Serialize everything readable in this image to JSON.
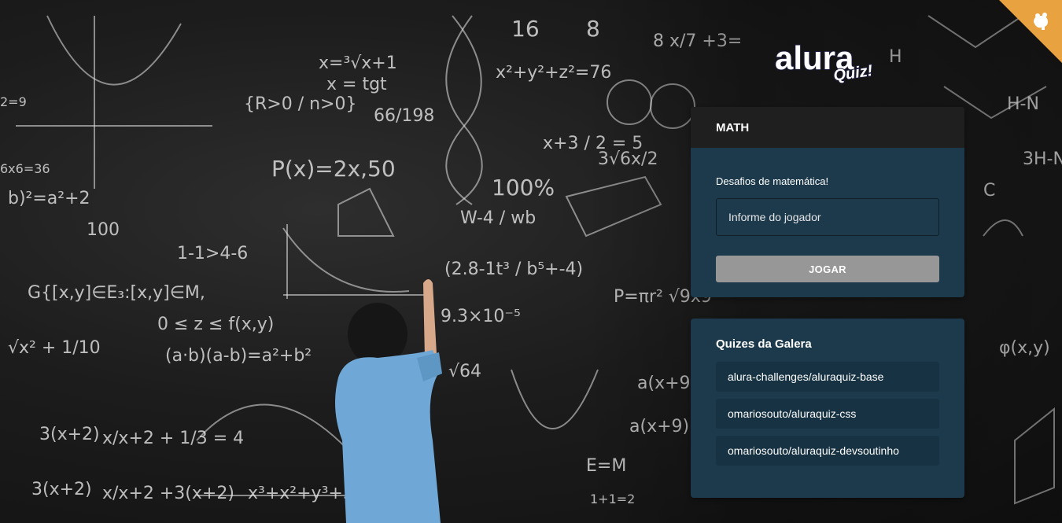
{
  "logo": {
    "brand": "alura",
    "suffix": "Quiz!"
  },
  "quiz_card": {
    "title": "MATH",
    "description": "Desafios de matemática!",
    "player_input": {
      "placeholder": "Informe do jogador",
      "value": ""
    },
    "play_button_label": "JOGAR"
  },
  "gallery_card": {
    "title": "Quizes da Galera",
    "items": [
      "alura-challenges/aluraquiz-base",
      "omariosouto/aluraquiz-css",
      "omariosouto/aluraquiz-devsoutinho"
    ]
  },
  "corner_badge": {
    "icon": "github-octocat-icon"
  },
  "colors": {
    "card_bg": "#1c3a4c",
    "card_header_bg": "#1f1f1f",
    "button_bg": "#979797",
    "corner_accent": "#e8a23f"
  }
}
